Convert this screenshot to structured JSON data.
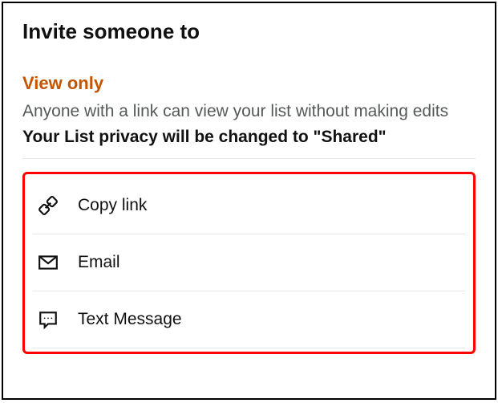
{
  "dialog": {
    "title": "Invite someone to",
    "subtitle": "View only",
    "description": "Anyone with a link can view your list without making edits",
    "notice": "Your List privacy will be changed to \"Shared\""
  },
  "options": [
    {
      "icon": "link-icon",
      "label": "Copy link"
    },
    {
      "icon": "email-icon",
      "label": "Email"
    },
    {
      "icon": "text-message-icon",
      "label": "Text Message"
    }
  ]
}
